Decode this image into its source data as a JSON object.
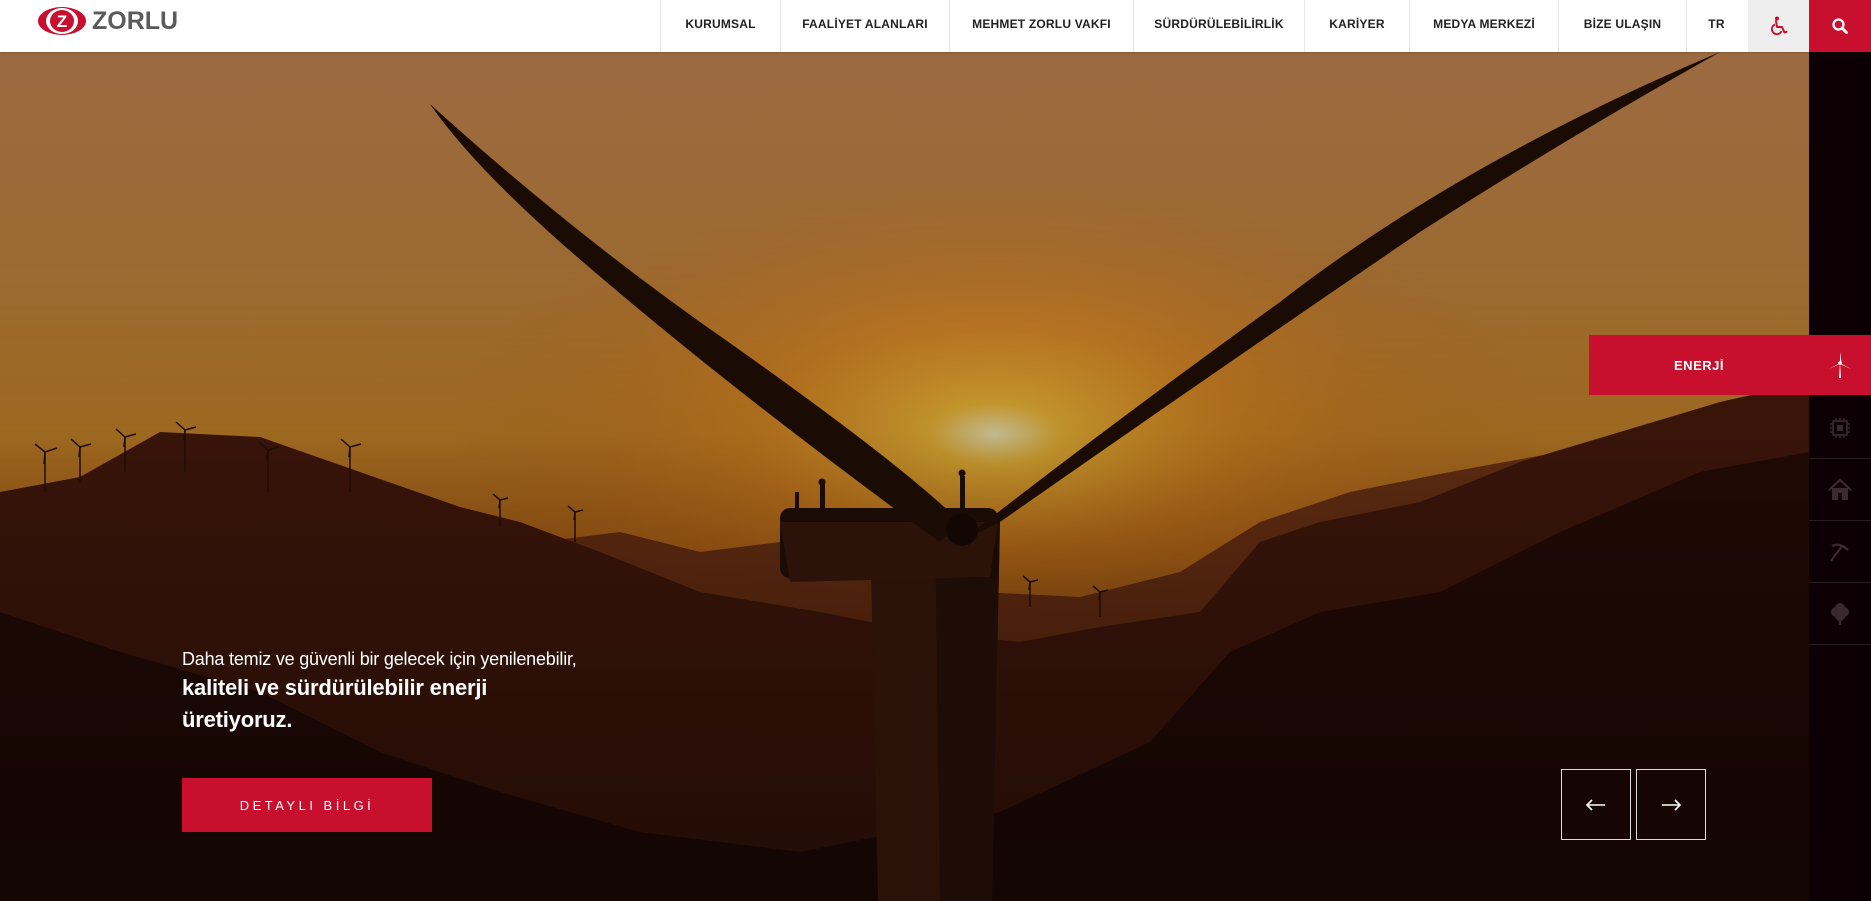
{
  "brand": {
    "name": "ZORLU",
    "mark_letter": "Z",
    "colors": {
      "accent": "#c8102e",
      "logo_grey": "#5b5b5b"
    }
  },
  "nav": {
    "items": [
      {
        "label": "KURUMSAL"
      },
      {
        "label": "FAALİYET ALANLARI"
      },
      {
        "label": "MEHMET ZORLU VAKFI"
      },
      {
        "label": "SÜRDÜRÜLEBİLİRLİK"
      },
      {
        "label": "KARİYER"
      },
      {
        "label": "MEDYA MERKEZİ"
      },
      {
        "label": "BİZE ULAŞIN"
      }
    ],
    "language": "TR",
    "accessibility_icon": "wheelchair-icon",
    "search_icon": "search-icon"
  },
  "hero": {
    "line1": "Daha temiz ve güvenli bir gelecek için yenilenebilir,",
    "line2": "kaliteli ve sürdürülebilir enerji",
    "line3": "üretiyoruz.",
    "cta_label": "DETAYLI BİLGİ",
    "prev_label": "←",
    "next_label": "→"
  },
  "sectors": {
    "active": {
      "label": "ENERJİ",
      "icon": "wind-turbine-icon"
    },
    "items": [
      {
        "icon": "chip-icon"
      },
      {
        "icon": "home-icon"
      },
      {
        "icon": "pickaxe-icon"
      },
      {
        "icon": "cotton-icon"
      }
    ]
  }
}
